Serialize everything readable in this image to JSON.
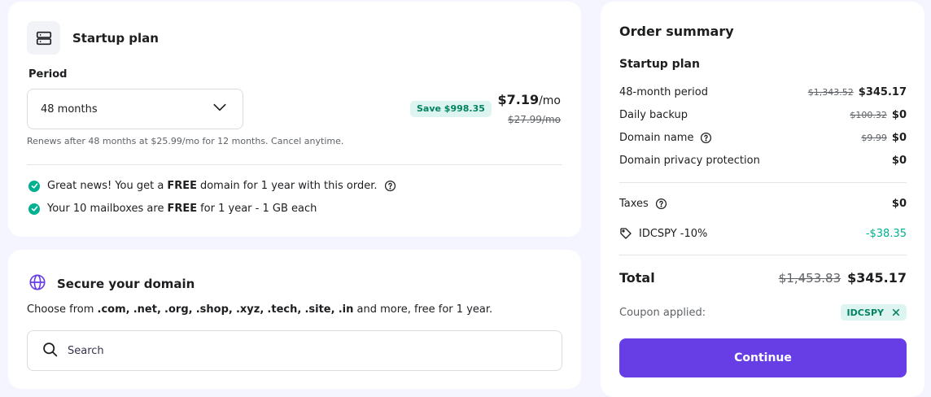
{
  "plan_card": {
    "title": "Startup plan",
    "icon": "server-icon",
    "period_label": "Period",
    "period_value": "48 months",
    "save_badge": "Save $998.35",
    "price": "$7.19",
    "price_unit": "/mo",
    "price_old": "$27.99/mo",
    "renew_note": "Renews after 48 months at $25.99/mo for 12 months. Cancel anytime.",
    "perks": [
      {
        "before": "Great news! You get a",
        "bold": "FREE",
        "after": "domain for 1 year with this order."
      },
      {
        "before": "Your 10 mailboxes are",
        "bold": "FREE",
        "after": "for 1 year - 1 GB each"
      }
    ]
  },
  "domain_card": {
    "title": "Secure your domain",
    "icon": "globe-icon",
    "desc_prefix": "Choose from",
    "tlds": [
      ".com,",
      ".net,",
      ".org,",
      ".shop,",
      ".xyz,",
      ".tech,",
      ".site,",
      ".in"
    ],
    "desc_suffix": "and more, free for 1 year.",
    "search_placeholder": "Search"
  },
  "summary": {
    "title": "Order summary",
    "plan": "Startup plan",
    "lines": [
      {
        "label": "48-month period",
        "old": "$1,343.52",
        "value": "$345.17"
      },
      {
        "label": "Daily backup",
        "old": "$100.32",
        "value": "$0"
      },
      {
        "label": "Domain name",
        "old": "$9.99",
        "value": "$0"
      },
      {
        "label": "Domain privacy protection",
        "old": "",
        "value": "$0"
      }
    ],
    "taxes_label": "Taxes",
    "taxes_value": "$0",
    "discount_label": "IDCSPY -10%",
    "discount_value": "-$38.35",
    "total_label": "Total",
    "total_old": "$1,453.83",
    "total_value": "$345.17",
    "coupon_label": "Coupon applied:",
    "coupon_code": "IDCSPY",
    "continue_label": "Continue"
  },
  "colors": {
    "accent": "#673de6",
    "success": "#00b090",
    "badge_bg": "#def4f0",
    "background": "#f4f5ff"
  }
}
